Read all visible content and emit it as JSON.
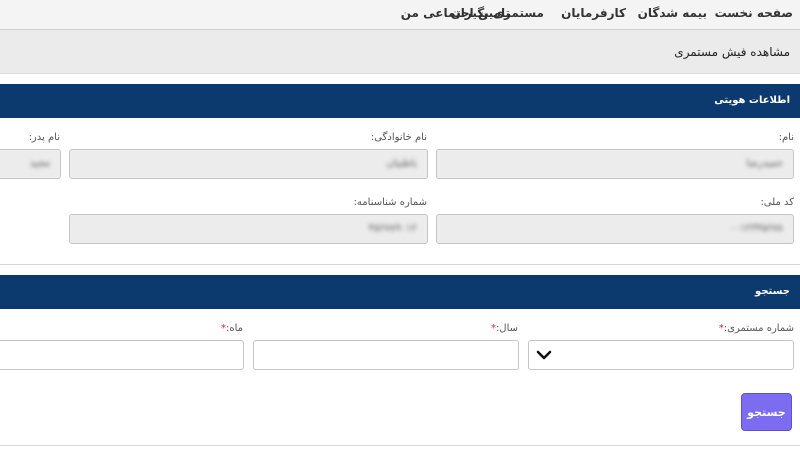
{
  "nav": {
    "home": "صفحه نخست",
    "insured": "بیمه شدگان",
    "employers": "کارفرمایان",
    "pensioners": "مستمری بگیران",
    "my_social_security": "تامین اجتماعی من"
  },
  "page": {
    "title": "مشاهده فیش مستمری"
  },
  "identity": {
    "heading": "اطلاعات هویتی",
    "first_name": {
      "label": "نام:",
      "value": "حمیدرضا"
    },
    "last_name": {
      "label": "نام خانوادگی:",
      "value": "باطنیان"
    },
    "father_name": {
      "label": "نام پدر:",
      "value": "مجید"
    },
    "national_code": {
      "label": "کد ملی:",
      "value": "۰۰۱۲۳۴۵۶۷۸"
    },
    "birth_cert_no": {
      "label": "شماره شناسنامه:",
      "value": "۴۵۶۷۸۹۰۱۲"
    }
  },
  "search": {
    "heading": "جستجو",
    "pension_no": {
      "label": "شماره مستمری:",
      "required_mark": "*"
    },
    "year": {
      "label": "سال:",
      "required_mark": "*"
    },
    "month": {
      "label": "ماه:",
      "required_mark": "*"
    },
    "button_label": "جستجو"
  },
  "icons": {
    "dropdown": "chevron-down-icon"
  },
  "colors": {
    "section_header": "#0c3a6e",
    "button": "#7c6cf0",
    "required": "#e02424"
  }
}
